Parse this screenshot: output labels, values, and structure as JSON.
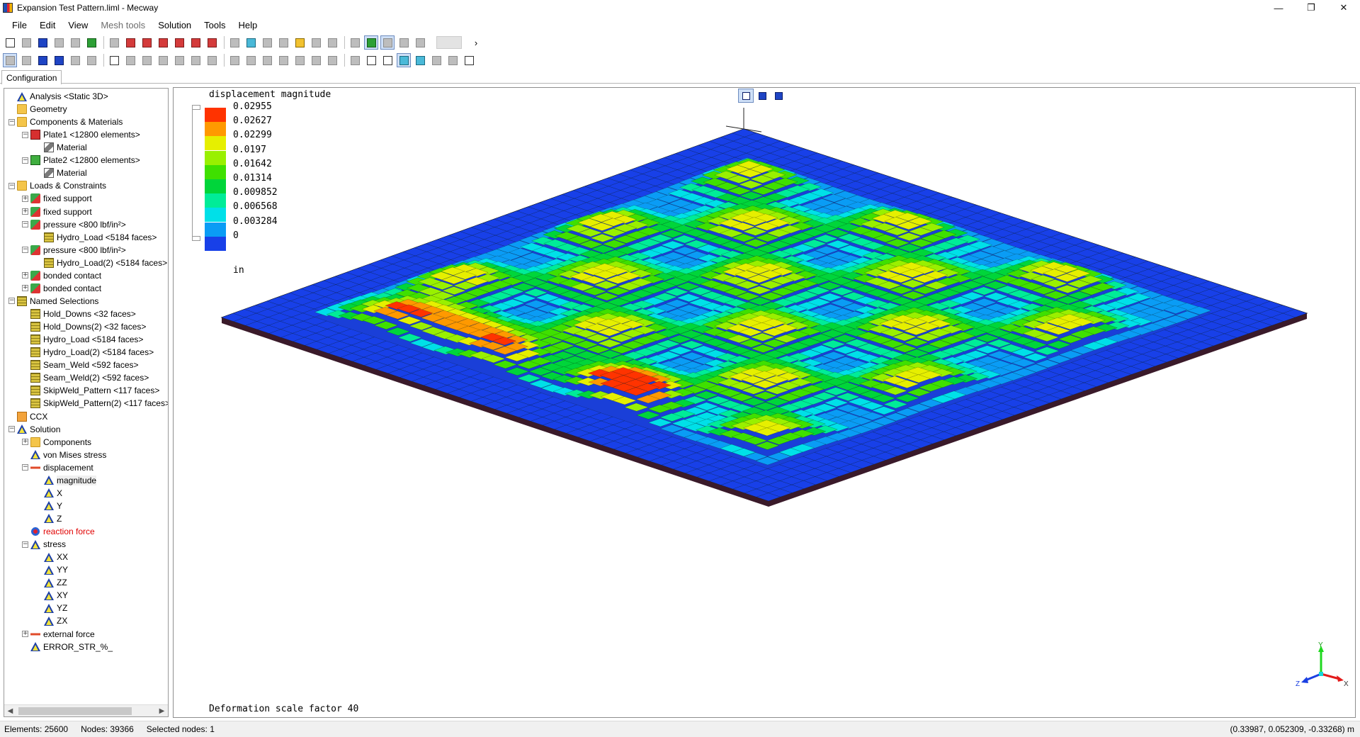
{
  "window": {
    "title": "Expansion Test Pattern.liml - Mecway",
    "minimize_glyph": "—",
    "restore_glyph": "❐",
    "close_glyph": "✕"
  },
  "menu": {
    "items": [
      {
        "label": "File",
        "disabled": false
      },
      {
        "label": "Edit",
        "disabled": false
      },
      {
        "label": "View",
        "disabled": false
      },
      {
        "label": "Mesh tools",
        "disabled": true
      },
      {
        "label": "Solution",
        "disabled": false
      },
      {
        "label": "Tools",
        "disabled": false
      },
      {
        "label": "Help",
        "disabled": false
      }
    ]
  },
  "tabs": {
    "active": "Configuration"
  },
  "tree": {
    "items": [
      {
        "label": "Analysis <Static 3D>",
        "indent": 0,
        "icon": "triangle",
        "exp": "none"
      },
      {
        "label": "Geometry",
        "indent": 0,
        "icon": "folder",
        "exp": "none"
      },
      {
        "label": "Components & Materials",
        "indent": 0,
        "icon": "folder",
        "exp": "−"
      },
      {
        "label": "Plate1 <12800 elements>",
        "indent": 1,
        "icon": "part-red",
        "exp": "−"
      },
      {
        "label": "Material",
        "indent": 2,
        "icon": "mat",
        "exp": "none"
      },
      {
        "label": "Plate2 <12800 elements>",
        "indent": 1,
        "icon": "part-green",
        "exp": "−"
      },
      {
        "label": "Material",
        "indent": 2,
        "icon": "mat",
        "exp": "none"
      },
      {
        "label": "Loads & Constraints",
        "indent": 0,
        "icon": "folder",
        "exp": "−"
      },
      {
        "label": "fixed support",
        "indent": 1,
        "icon": "load",
        "exp": "+"
      },
      {
        "label": "fixed support",
        "indent": 1,
        "icon": "load",
        "exp": "+"
      },
      {
        "label": "pressure <800 lbf/in²>",
        "indent": 1,
        "icon": "load",
        "exp": "−"
      },
      {
        "label": "Hydro_Load <5184 faces>",
        "indent": 2,
        "icon": "face",
        "exp": "none"
      },
      {
        "label": "pressure <800 lbf/in²>",
        "indent": 1,
        "icon": "load",
        "exp": "−"
      },
      {
        "label": "Hydro_Load(2) <5184 faces>",
        "indent": 2,
        "icon": "face",
        "exp": "none"
      },
      {
        "label": "bonded contact",
        "indent": 1,
        "icon": "load",
        "exp": "+"
      },
      {
        "label": "bonded contact",
        "indent": 1,
        "icon": "load",
        "exp": "+"
      },
      {
        "label": "Named Selections",
        "indent": 0,
        "icon": "face",
        "exp": "−"
      },
      {
        "label": "Hold_Downs <32 faces>",
        "indent": 1,
        "icon": "face",
        "exp": "none"
      },
      {
        "label": "Hold_Downs(2) <32 faces>",
        "indent": 1,
        "icon": "face",
        "exp": "none"
      },
      {
        "label": "Hydro_Load <5184 faces>",
        "indent": 1,
        "icon": "face",
        "exp": "none"
      },
      {
        "label": "Hydro_Load(2) <5184 faces>",
        "indent": 1,
        "icon": "face",
        "exp": "none"
      },
      {
        "label": "Seam_Weld <592 faces>",
        "indent": 1,
        "icon": "face",
        "exp": "none"
      },
      {
        "label": "Seam_Weld(2) <592 faces>",
        "indent": 1,
        "icon": "face",
        "exp": "none"
      },
      {
        "label": "SkipWeld_Pattern <117 faces>",
        "indent": 1,
        "icon": "face",
        "exp": "none"
      },
      {
        "label": "SkipWeld_Pattern(2) <117 faces>",
        "indent": 1,
        "icon": "face",
        "exp": "none"
      },
      {
        "label": "CCX",
        "indent": 0,
        "icon": "ccx",
        "exp": "none"
      },
      {
        "label": "Solution",
        "indent": 0,
        "icon": "triangle",
        "exp": "−"
      },
      {
        "label": "Components",
        "indent": 1,
        "icon": "folder",
        "exp": "+"
      },
      {
        "label": "von Mises stress",
        "indent": 1,
        "icon": "triangle",
        "exp": "none"
      },
      {
        "label": "displacement",
        "indent": 1,
        "icon": "disp",
        "exp": "−"
      },
      {
        "label": "magnitude",
        "indent": 2,
        "icon": "triangle",
        "exp": "none",
        "selected": true
      },
      {
        "label": "X",
        "indent": 2,
        "icon": "triangle",
        "exp": "none"
      },
      {
        "label": "Y",
        "indent": 2,
        "icon": "triangle",
        "exp": "none"
      },
      {
        "label": "Z",
        "indent": 2,
        "icon": "triangle",
        "exp": "none"
      },
      {
        "label": "reaction force",
        "indent": 1,
        "icon": "react",
        "exp": "none",
        "red": true
      },
      {
        "label": "stress",
        "indent": 1,
        "icon": "triangle",
        "exp": "−"
      },
      {
        "label": "XX",
        "indent": 2,
        "icon": "triangle",
        "exp": "none"
      },
      {
        "label": "YY",
        "indent": 2,
        "icon": "triangle",
        "exp": "none"
      },
      {
        "label": "ZZ",
        "indent": 2,
        "icon": "triangle",
        "exp": "none"
      },
      {
        "label": "XY",
        "indent": 2,
        "icon": "triangle",
        "exp": "none"
      },
      {
        "label": "YZ",
        "indent": 2,
        "icon": "triangle",
        "exp": "none"
      },
      {
        "label": "ZX",
        "indent": 2,
        "icon": "triangle",
        "exp": "none"
      },
      {
        "label": "external force",
        "indent": 1,
        "icon": "disp",
        "exp": "+"
      },
      {
        "label": "ERROR_STR_%_",
        "indent": 1,
        "icon": "triangle",
        "exp": "none"
      }
    ]
  },
  "viewport": {
    "plot_title": "displacement magnitude",
    "legend": [
      {
        "label": "0.02955",
        "color": "#ff3300"
      },
      {
        "label": "0.02627",
        "color": "#ff9900"
      },
      {
        "label": "0.02299",
        "color": "#e6ef00"
      },
      {
        "label": "0.0197",
        "color": "#99f000"
      },
      {
        "label": "0.01642",
        "color": "#3fe000"
      },
      {
        "label": "0.01314",
        "color": "#00d53a"
      },
      {
        "label": "0.009852",
        "color": "#00ec98"
      },
      {
        "label": "0.006568",
        "color": "#00e0e8"
      },
      {
        "label": "0.003284",
        "color": "#0a9cf5"
      },
      {
        "label": "0",
        "color": "#1840e8"
      }
    ],
    "unit": "in",
    "deformation_text": "Deformation scale factor 40",
    "triad": {
      "x": "X",
      "y": "Y",
      "z": "Z"
    }
  },
  "status": {
    "elements": "Elements: 25600",
    "nodes": "Nodes: 39366",
    "selected": "Selected nodes: 1",
    "coords": "(0.33987, 0.052309, -0.33268) m"
  },
  "toolbar": {
    "row1": [
      "white",
      "grey",
      "blue",
      "grey",
      "grey",
      "green",
      "grey",
      "red",
      "red",
      "red",
      "red",
      "red",
      "red",
      "grey",
      "cyan",
      "grey",
      "grey",
      "yellow",
      "grey",
      "grey",
      "grey",
      "green",
      "grey",
      "grey",
      "grey"
    ],
    "row2": [
      "grey",
      "grey",
      "blue",
      "blue",
      "grey",
      "grey",
      "white",
      "grey",
      "grey",
      "grey",
      "grey",
      "grey",
      "grey",
      "grey",
      "grey",
      "grey",
      "grey",
      "grey",
      "grey",
      "grey",
      "grey",
      "white",
      "white",
      "cyan",
      "cyan",
      "grey",
      "grey",
      "white"
    ]
  }
}
